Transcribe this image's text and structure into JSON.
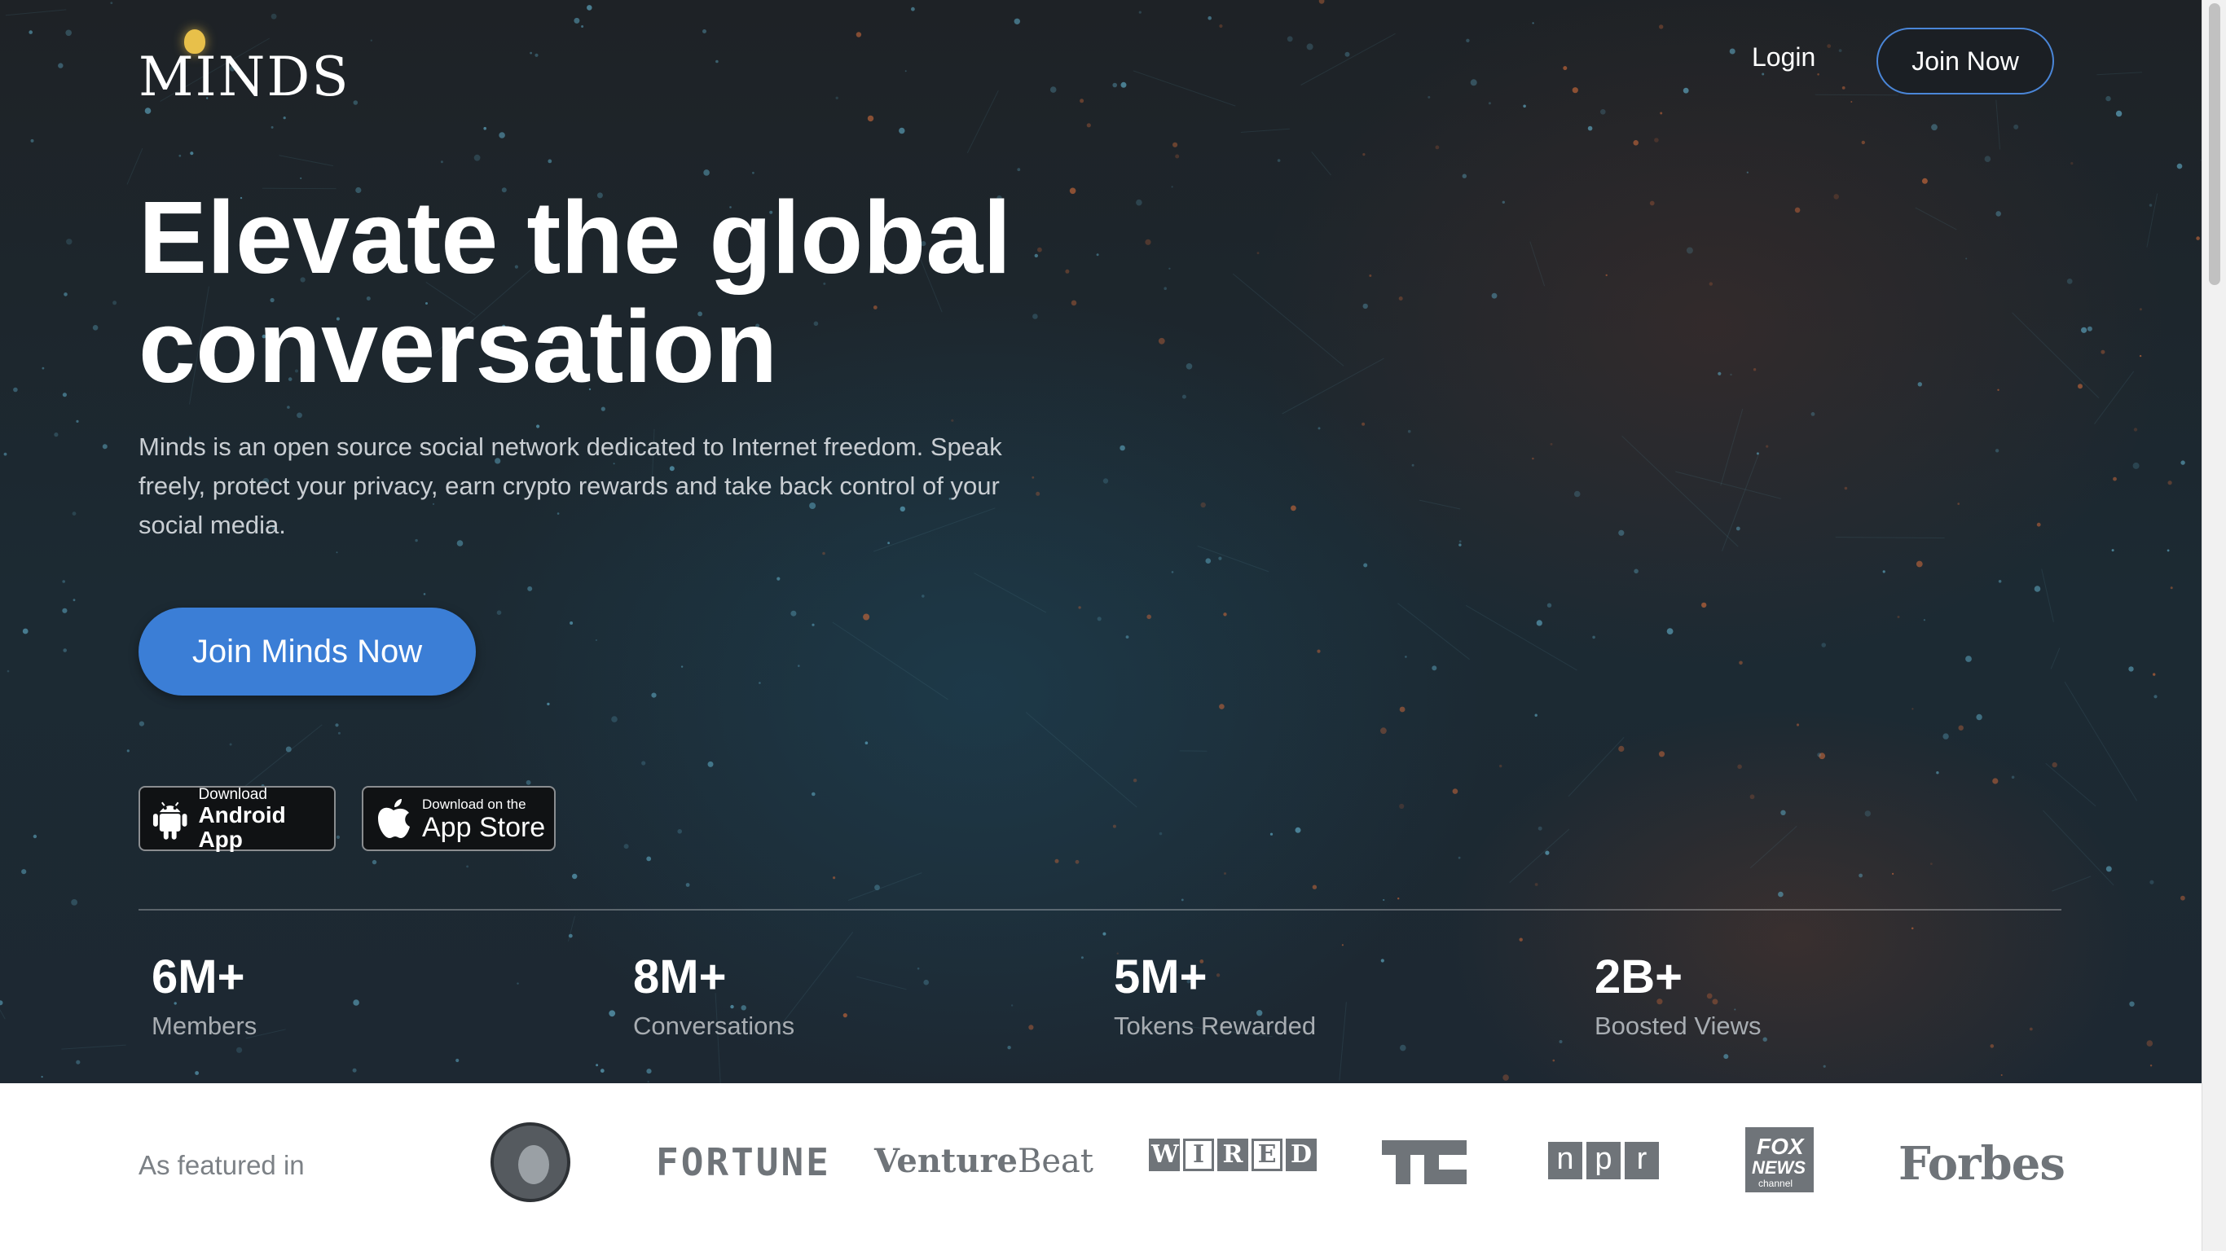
{
  "header": {
    "logo_text": "MINDS",
    "login_label": "Login",
    "join_label": "Join Now"
  },
  "hero": {
    "headline_line1": "Elevate the global",
    "headline_line2": "conversation",
    "subcopy": "Minds is an open source social network dedicated to Internet freedom. Speak freely, protect your privacy, earn crypto rewards and take back control of your social media.",
    "cta_label": "Join Minds Now"
  },
  "badges": {
    "android_small": "Download",
    "android_big": "Android App",
    "apple_small": "Download on the",
    "apple_big": "App Store"
  },
  "stats": [
    {
      "value": "6M+",
      "label": "Members"
    },
    {
      "value": "8M+",
      "label": "Conversations"
    },
    {
      "value": "5M+",
      "label": "Tokens Rewarded"
    },
    {
      "value": "2B+",
      "label": "Boosted Views"
    }
  ],
  "featured": {
    "label": "As featured in",
    "logos": {
      "rogan": "THE JOE ROGAN EXPERIENCE",
      "fortune": "FORTUNE",
      "venturebeat_a": "Venture",
      "venturebeat_b": "Beat",
      "wired": [
        "W",
        "I",
        "R",
        "E",
        "D"
      ],
      "techcrunch": "TC",
      "npr": [
        "n",
        "p",
        "r"
      ],
      "fox_line1": "FOX",
      "fox_line2": "NEWS",
      "fox_line3": "channel",
      "forbes": "Forbes"
    }
  },
  "colors": {
    "accent_blue": "#3b7ed6",
    "hero_dark": "#1e2226",
    "text_light": "#c9ced3",
    "stat_label": "#a8adb2",
    "logo_gray": "#6f7479"
  },
  "icons": {
    "android": "android-robot-icon",
    "apple": "apple-logo-icon"
  }
}
